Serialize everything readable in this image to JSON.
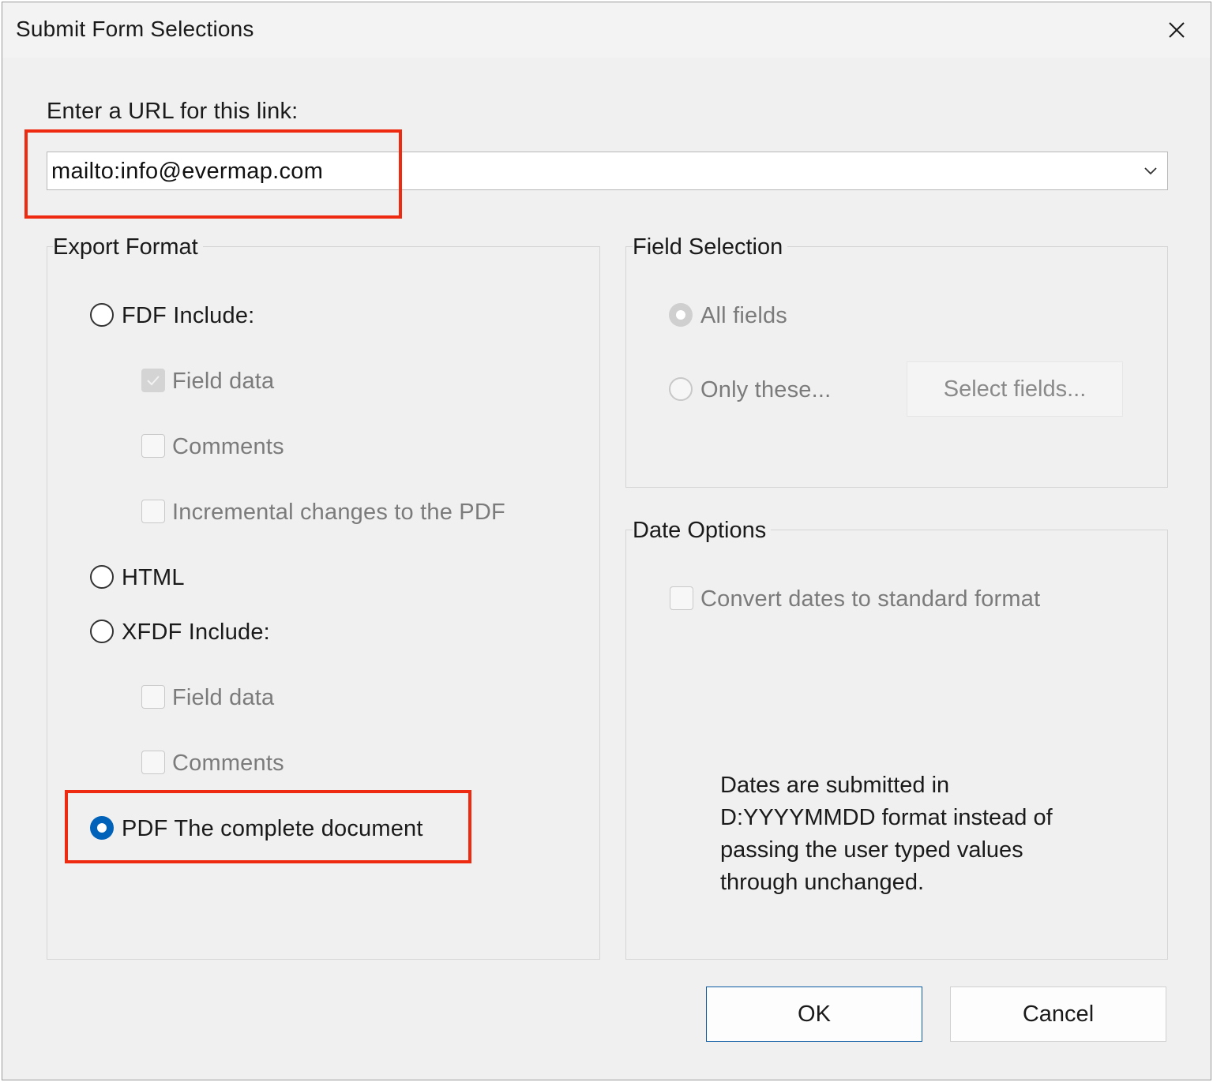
{
  "window": {
    "title": "Submit Form Selections",
    "close_icon": "close-icon"
  },
  "url": {
    "label": "Enter a URL for this link:",
    "value": "mailto:info@evermap.com",
    "dropdown_icon": "chevron-down-icon"
  },
  "export_format": {
    "group_label": "Export Format",
    "fdf_label": "FDF  Include:",
    "fdf_selected": false,
    "fdf_field_data": {
      "label": "Field data",
      "checked": true
    },
    "fdf_comments": {
      "label": "Comments",
      "checked": false
    },
    "fdf_incremental": {
      "label": "Incremental changes to the PDF",
      "checked": false
    },
    "html_label": "HTML",
    "html_selected": false,
    "xfdf_label": "XFDF  Include:",
    "xfdf_selected": false,
    "xfdf_field_data": {
      "label": "Field data",
      "checked": false
    },
    "xfdf_comments": {
      "label": "Comments",
      "checked": false
    },
    "pdf_label": "PDF  The complete document",
    "pdf_selected": true
  },
  "field_selection": {
    "group_label": "Field Selection",
    "all_fields_label": "All fields",
    "all_fields_selected": true,
    "only_these_label": "Only these...",
    "only_these_selected": false,
    "select_fields_button": "Select fields..."
  },
  "date_options": {
    "group_label": "Date Options",
    "convert_label": "Convert dates to standard format",
    "convert_checked": false,
    "note": "Dates are submitted in D:YYYYMMDD format instead of passing the user typed values through unchanged."
  },
  "buttons": {
    "ok": "OK",
    "cancel": "Cancel"
  },
  "colors": {
    "highlight": "#ee2a10",
    "accent": "#0062b8"
  }
}
